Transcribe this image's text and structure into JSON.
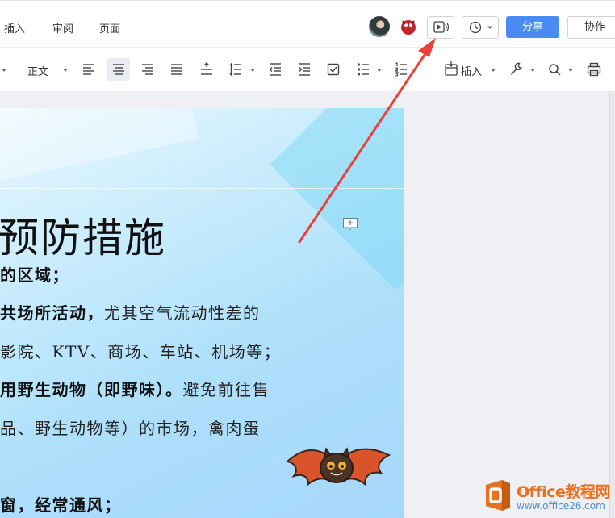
{
  "menubar": {
    "items": [
      "插入",
      "审阅",
      "页面"
    ],
    "share_label": "分享",
    "collab_label": "协作",
    "icons": [
      "avatar-user",
      "avatar-user-2",
      "present-icon",
      "history-icon"
    ]
  },
  "toolbar": {
    "style_label": "正文",
    "insert_label": "插入",
    "icons": [
      "align-left-icon",
      "align-center-icon",
      "align-right-icon",
      "justify-icon",
      "line-spacing-icon",
      "paragraph-spacing-icon",
      "outdent-icon",
      "indent-icon",
      "checkbox-icon",
      "bullet-list-icon",
      "numbered-list-icon",
      "insert-icon",
      "tools-icon",
      "search-icon",
      "print-icon"
    ]
  },
  "document": {
    "title": "预防措施",
    "lines": [
      {
        "bold": "的区域；",
        "normal": ""
      },
      {
        "bold": "共场所活动，",
        "normal": "尤其空气流动性差的"
      },
      {
        "bold": "",
        "normal": "影院、KTV、商场、车站、机场等；"
      },
      {
        "bold": "用野生动物（即野味）。",
        "normal": "避免前往售"
      },
      {
        "bold": "",
        "normal": "品、野生动物等）的市场，禽肉蛋"
      },
      {
        "bold": "窗，经常通风；",
        "normal": ""
      }
    ]
  },
  "watermark": {
    "title": "Office教程网",
    "url": "www.office26.com"
  },
  "colors": {
    "share_button": "#4a8af4",
    "arrow": "#e8423a",
    "page_gradient_light": "#eaf8ff",
    "page_gradient_dark": "#a6d7fb",
    "watermark_orange": "#e8701f"
  }
}
